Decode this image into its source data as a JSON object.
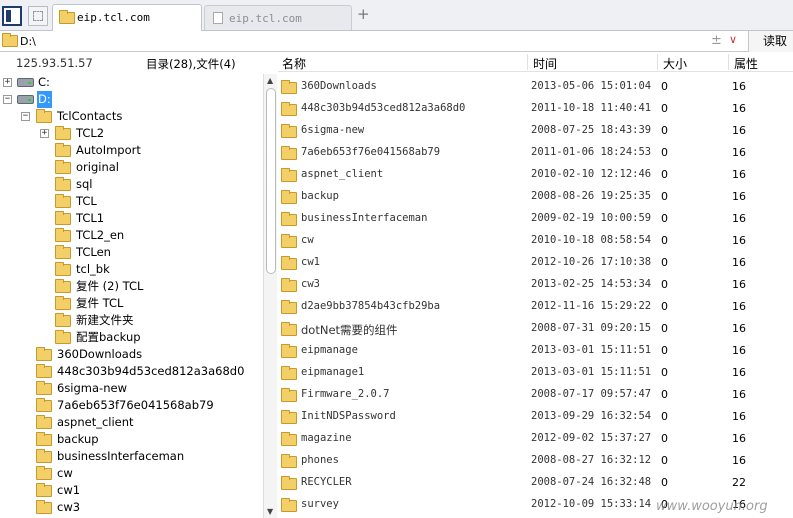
{
  "tabs": [
    {
      "label": "eip.tcl.com",
      "active": true
    },
    {
      "label": "eip.tcl.com",
      "active": false
    }
  ],
  "new_tab": "+",
  "path": {
    "value": "D:\\",
    "plus": "±",
    "dropdown": "∨",
    "read_button": "读取"
  },
  "info": {
    "ip": "125.93.51.57",
    "summary": "目录(28),文件(4)"
  },
  "tree": {
    "drives": [
      {
        "label": "C:",
        "toggle": "+"
      },
      {
        "label": "D:",
        "toggle": "−"
      }
    ],
    "tclcontacts": {
      "label": "TclContacts",
      "toggle": "−"
    },
    "tclcontacts_children": [
      {
        "label": "TCL2",
        "toggle": "+"
      },
      {
        "label": "AutoImport"
      },
      {
        "label": "original"
      },
      {
        "label": "sql"
      },
      {
        "label": "TCL"
      },
      {
        "label": "TCL1"
      },
      {
        "label": "TCL2_en"
      },
      {
        "label": "TCLen"
      },
      {
        "label": "tcl_bk"
      },
      {
        "label": "复件 (2) TCL"
      },
      {
        "label": "复件 TCL"
      },
      {
        "label": "新建文件夹"
      },
      {
        "label": "配置backup"
      }
    ],
    "d_children": [
      {
        "label": "360Downloads"
      },
      {
        "label": "448c303b94d53ced812a3a68d0"
      },
      {
        "label": "6sigma-new"
      },
      {
        "label": "7a6eb653f76e041568ab79"
      },
      {
        "label": "aspnet_client"
      },
      {
        "label": "backup"
      },
      {
        "label": "businessInterfaceman"
      },
      {
        "label": "cw"
      },
      {
        "label": "cw1"
      },
      {
        "label": "cw3"
      }
    ]
  },
  "columns": {
    "name": "名称",
    "time": "时间",
    "size": "大小",
    "attr": "属性"
  },
  "rows": [
    {
      "name": "360Downloads",
      "time": "2013-05-06 15:01:04",
      "size": "0",
      "attr": "16"
    },
    {
      "name": "448c303b94d53ced812a3a68d0",
      "time": "2011-10-18 11:40:41",
      "size": "0",
      "attr": "16"
    },
    {
      "name": "6sigma-new",
      "time": "2008-07-25 18:43:39",
      "size": "0",
      "attr": "16"
    },
    {
      "name": "7a6eb653f76e041568ab79",
      "time": "2011-01-06 18:24:53",
      "size": "0",
      "attr": "16"
    },
    {
      "name": "aspnet_client",
      "time": "2010-02-10 12:12:46",
      "size": "0",
      "attr": "16"
    },
    {
      "name": "backup",
      "time": "2008-08-26 19:25:35",
      "size": "0",
      "attr": "16"
    },
    {
      "name": "businessInterfaceman",
      "time": "2009-02-19 10:00:59",
      "size": "0",
      "attr": "16"
    },
    {
      "name": "cw",
      "time": "2010-10-18 08:58:54",
      "size": "0",
      "attr": "16"
    },
    {
      "name": "cw1",
      "time": "2012-10-26 17:10:38",
      "size": "0",
      "attr": "16"
    },
    {
      "name": "cw3",
      "time": "2013-02-25 14:53:34",
      "size": "0",
      "attr": "16"
    },
    {
      "name": "d2ae9bb37854b43cfb29ba",
      "time": "2012-11-16 15:29:22",
      "size": "0",
      "attr": "16"
    },
    {
      "name": "dotNet需要的组件",
      "time": "2008-07-31 09:20:15",
      "size": "0",
      "attr": "16"
    },
    {
      "name": "eipmanage",
      "time": "2013-03-01 15:11:51",
      "size": "0",
      "attr": "16"
    },
    {
      "name": "eipmanage1",
      "time": "2013-03-01 15:11:51",
      "size": "0",
      "attr": "16"
    },
    {
      "name": "Firmware_2.0.7",
      "time": "2008-07-17 09:57:47",
      "size": "0",
      "attr": "16"
    },
    {
      "name": "InitNDSPassword",
      "time": "2013-09-29 16:32:54",
      "size": "0",
      "attr": "16"
    },
    {
      "name": "magazine",
      "time": "2012-09-02 15:37:27",
      "size": "0",
      "attr": "16"
    },
    {
      "name": "phones",
      "time": "2008-08-27 16:32:12",
      "size": "0",
      "attr": "16"
    },
    {
      "name": "RECYCLER",
      "time": "2008-07-24 16:32:48",
      "size": "0",
      "attr": "22"
    },
    {
      "name": "survey",
      "time": "2012-10-09 15:33:14",
      "size": "0",
      "attr": "16"
    }
  ],
  "watermark": "www.wooyun.org"
}
